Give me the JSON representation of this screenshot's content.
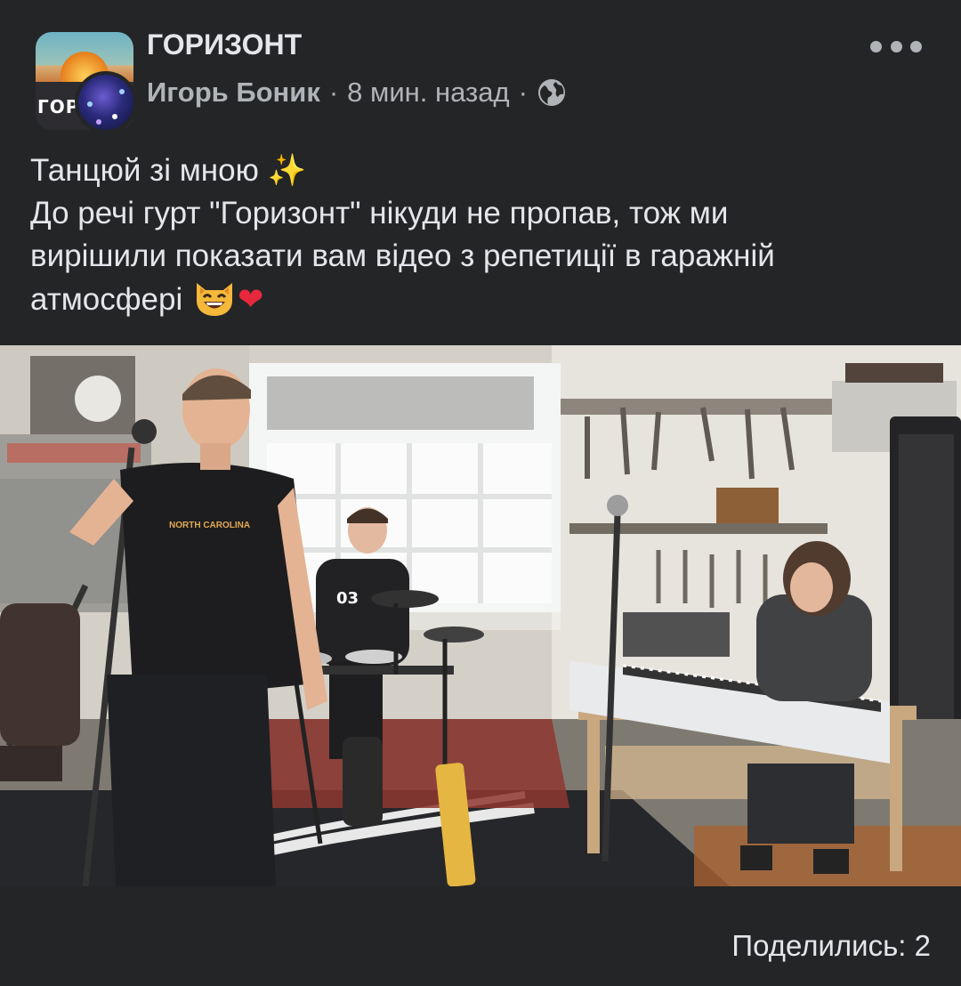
{
  "post": {
    "group_name": "ГОРИЗОНТ",
    "group_avatar_text": "ГОР",
    "author": "Игорь Боник",
    "separator": "·",
    "time": "8 мин. назад",
    "privacy_icon": "globe-icon",
    "menu_icon": "more-options-icon",
    "text_lines": [
      "Танцюй зі мною",
      "До речі гурт \"Горизонт\" нікуди не пропав, тож ми",
      "вирішили показати вам відео з репетиції в гаражній",
      "атмосфері"
    ],
    "emoji": {
      "sparkles": "✨",
      "grinning_cat": "grinning-cat-emoji",
      "heart": "❤"
    },
    "video": {
      "shirt_text": "NORTH CAROLINA",
      "drummer_shirt_number": "03"
    },
    "shares_label": "Поделились: 2"
  },
  "colors": {
    "background": "#242526",
    "primary_text": "#e4e6eb",
    "secondary_text": "#b0b3b8"
  }
}
